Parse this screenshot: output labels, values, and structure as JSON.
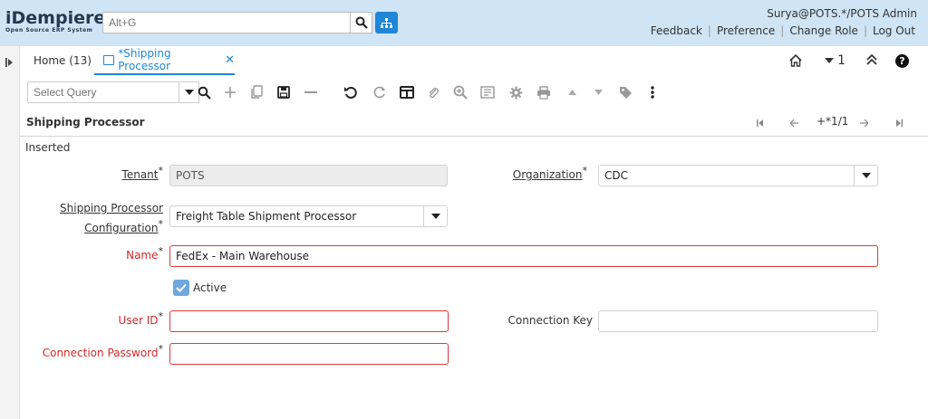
{
  "app": {
    "logo_main": "iDempiere",
    "logo_sub": "Open Source ERP System",
    "search_placeholder": "Alt+G",
    "user": "Surya@POTS.*/POTS Admin",
    "links": [
      "Feedback",
      "Preference",
      "Change Role",
      "Log Out"
    ]
  },
  "tabs": {
    "home": "Home (13)",
    "active": "*Shipping Processor",
    "close": "✕",
    "window_count": "1"
  },
  "toolbar": {
    "query_placeholder": "Select Query",
    "icons": [
      "search-icon",
      "new-icon",
      "copy-icon",
      "save-icon",
      "delete-icon",
      "undo-icon",
      "refresh-icon",
      "grid-toggle-icon",
      "attachment-icon",
      "zoom-icon",
      "report-icon",
      "process-icon",
      "print-icon",
      "previous-icon",
      "next-icon",
      "tag-icon",
      "more-icon"
    ]
  },
  "window": {
    "title": "Shipping Processor",
    "record_nav": "+*1/1",
    "status": "Inserted"
  },
  "form": {
    "tenant_label": "Tenant",
    "tenant_value": "POTS",
    "org_label": "Organization",
    "org_value": "CDC",
    "config_label_1": "Shipping Processor",
    "config_label_2": "Configuration",
    "config_value": "Freight Table Shipment Processor",
    "name_label": "Name",
    "name_value": "FedEx - Main Warehouse",
    "active_label": "Active",
    "active_checked": true,
    "userid_label": "User ID",
    "userid_value": "",
    "connkey_label": "Connection Key",
    "connkey_value": "",
    "connpw_label": "Connection Password",
    "connpw_value": "",
    "required_mark": "*"
  },
  "colors": {
    "header_bg": "#cfe4f5",
    "accent": "#1f86d8",
    "error": "#e03a3a",
    "checkbox": "#6fa8dc"
  }
}
